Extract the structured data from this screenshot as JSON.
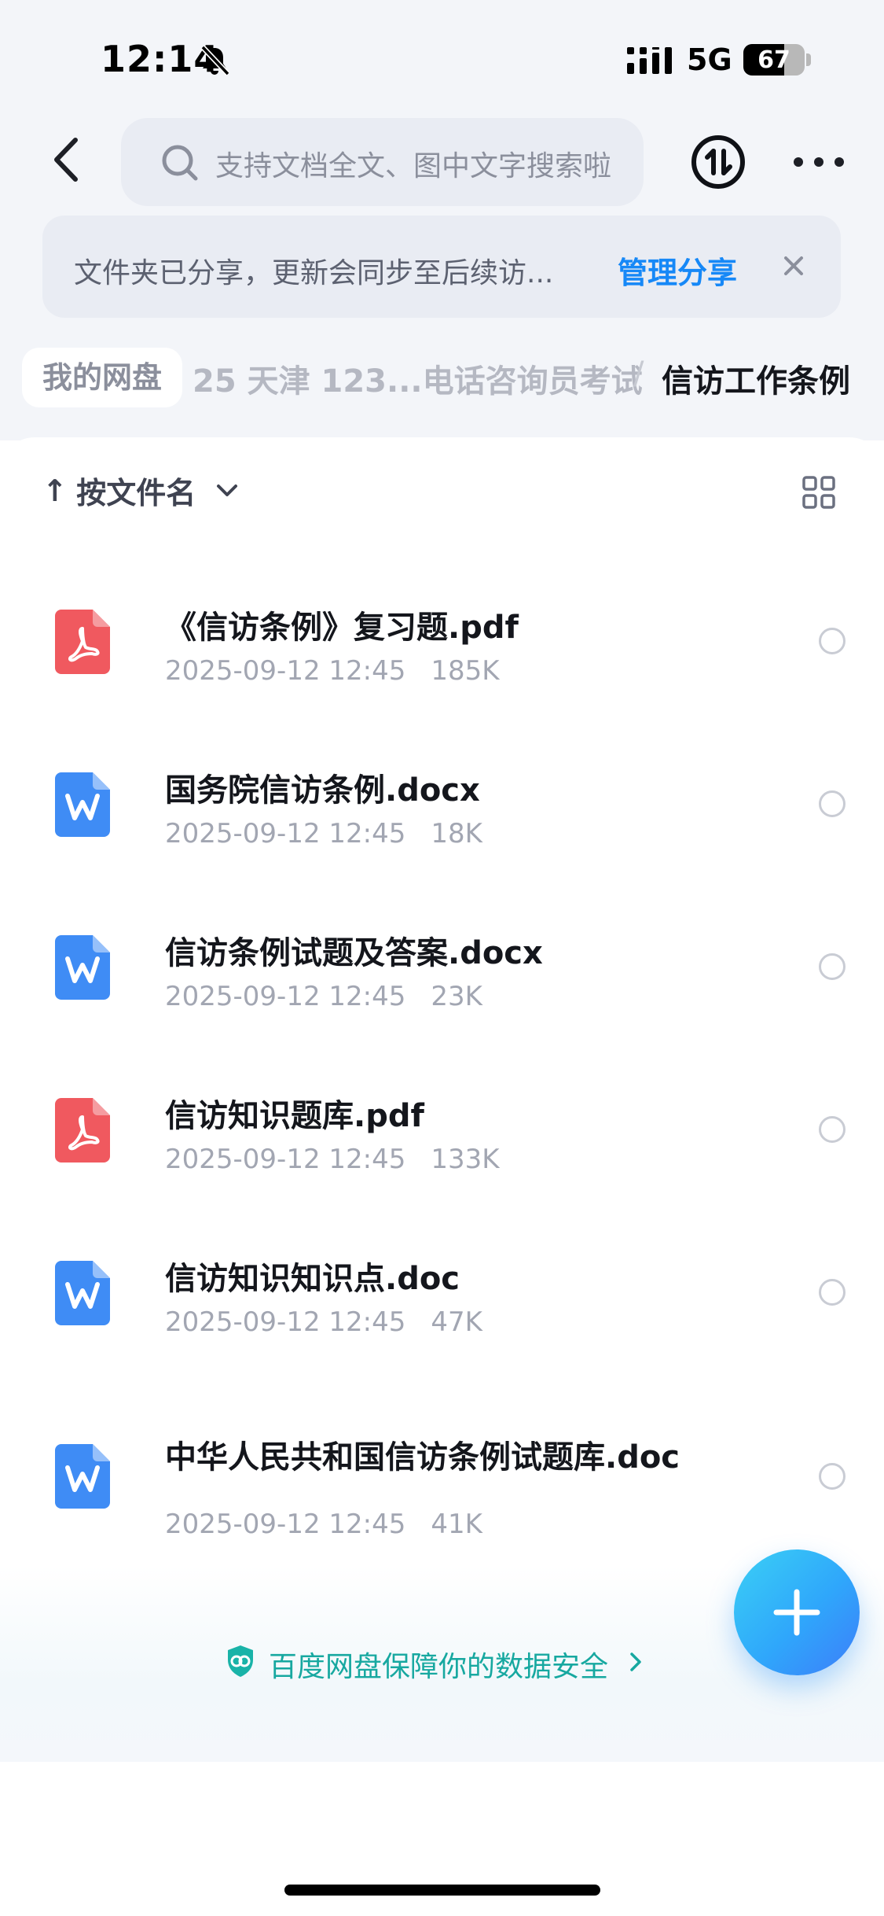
{
  "status_bar": {
    "time": "12:14",
    "network": "5G",
    "battery": "67",
    "battery_level_percent": 67,
    "icons": [
      "bell-slash-icon",
      "cellular-signal-icon"
    ]
  },
  "header": {
    "back_icon": "chevron-left-icon",
    "search_placeholder": "支持文档全文、图中文字搜索啦",
    "search_icon": "search-icon",
    "transfer_icon": "transfer-icon",
    "more_icon": "more-icon"
  },
  "share_banner": {
    "text": "文件夹已分享，更新会同步至后续访...",
    "action": "管理分享",
    "close_icon": "close-icon"
  },
  "breadcrumb": {
    "home": "我的网盘",
    "middle": "25 天津 123...电话咨询员考试",
    "separator": "/",
    "current": "信访工作条例"
  },
  "toolbar": {
    "sort_arrow": "↑",
    "sort_label": "按文件名",
    "sort_icon": "chevron-down-icon",
    "view_icon": "grid-view-icon"
  },
  "files": [
    {
      "name": "《信访条例》复习题.pdf",
      "date": "2025-09-12 12:45",
      "size": "185K",
      "type": "pdf"
    },
    {
      "name": "国务院信访条例.docx",
      "date": "2025-09-12 12:45",
      "size": "18K",
      "type": "word"
    },
    {
      "name": "信访条例试题及答案.docx",
      "date": "2025-09-12 12:45",
      "size": "23K",
      "type": "word"
    },
    {
      "name": "信访知识题库.pdf",
      "date": "2025-09-12 12:45",
      "size": "133K",
      "type": "pdf"
    },
    {
      "name": "信访知识知识点.doc",
      "date": "2025-09-12 12:45",
      "size": "47K",
      "type": "word"
    },
    {
      "name": "中华人民共和国信访条例试题库.doc",
      "date": "2025-09-12 12:45",
      "size": "41K",
      "type": "word"
    }
  ],
  "footer": {
    "security_text": "百度网盘保障你的数据安全",
    "security_icon": "shield-icon"
  },
  "fab": {
    "icon": "plus-icon"
  },
  "colors": {
    "accent": "#1688f7",
    "pdf": "#f0595f",
    "word": "#3f8cf5",
    "security": "#17a8a0",
    "fab_start": "#3bd0f5",
    "fab_end": "#3d7df9"
  }
}
